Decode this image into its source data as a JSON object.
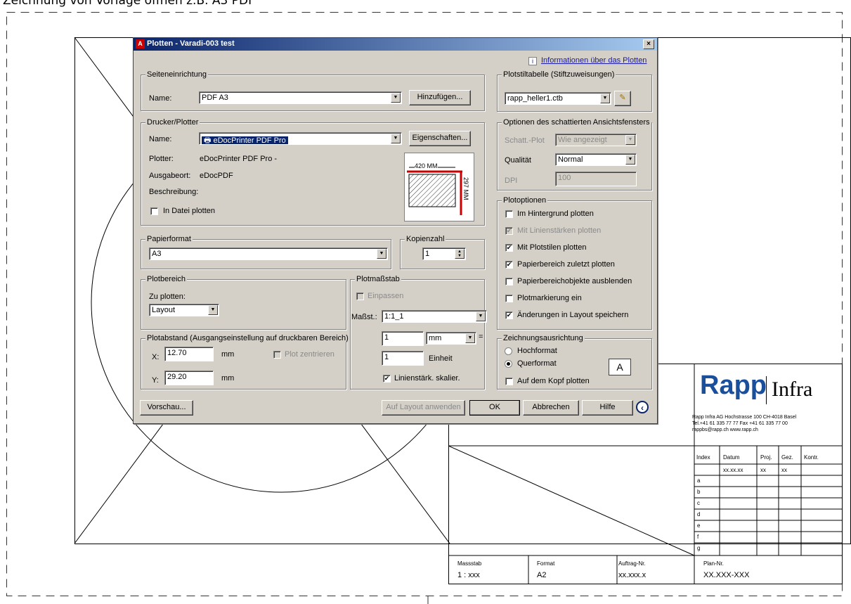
{
  "document": {
    "title": "Zeichnung von Vorlage öffnen z.B. A3 PDF"
  },
  "dialog": {
    "title": "Plotten - Varadi-003 test",
    "close_label": "×",
    "info_link": "Informationen über das Plotten",
    "page_setup": {
      "group": "Seiteneinrichtung",
      "name_label": "Name:",
      "name_value": "PDF A3",
      "add_button": "Hinzufügen..."
    },
    "printer": {
      "group": "Drucker/Plotter",
      "name_label": "Name:",
      "name_value": "eDocPrinter PDF Pro",
      "properties_button": "Eigenschaften...",
      "plotter_label": "Plotter:",
      "plotter_value": "eDocPrinter PDF Pro -",
      "output_label": "Ausgabeort:",
      "output_value": "eDocPDF",
      "desc_label": "Beschreibung:",
      "to_file_label": "In Datei plotten",
      "preview_width": "420 MM",
      "preview_height": "297 MM"
    },
    "paper": {
      "group": "Papierformat",
      "value": "A3"
    },
    "copies": {
      "group": "Kopienzahl",
      "value": "1"
    },
    "plot_area": {
      "group": "Plotbereich",
      "what_label": "Zu plotten:",
      "what_value": "Layout"
    },
    "plot_scale": {
      "group": "Plotmaßstab",
      "fit_label": "Einpassen",
      "scale_label": "Maßst.:",
      "scale_value": "1:1_1",
      "value1": "1",
      "unit": "mm",
      "equals": "=",
      "value2": "1",
      "unit2": "Einheit",
      "lineweight_label": "Linienstärk. skalier."
    },
    "offset": {
      "group": "Plotabstand (Ausgangseinstellung auf druckbaren Bereich)",
      "x_label": "X:",
      "x_value": "12.70",
      "x_unit": "mm",
      "center_label": "Plot zentrieren",
      "y_label": "Y:",
      "y_value": "29.20",
      "y_unit": "mm"
    },
    "style_table": {
      "group": "Plotstiltabelle (Stiftzuweisungen)",
      "value": "rapp_heller1.ctb"
    },
    "shaded": {
      "group": "Optionen des schattierten Ansichtsfensters",
      "shade_label": "Schatt.-Plot",
      "shade_value": "Wie angezeigt",
      "quality_label": "Qualität",
      "quality_value": "Normal",
      "dpi_label": "DPI",
      "dpi_value": "100"
    },
    "plot_options": {
      "group": "Plotoptionen",
      "items": [
        {
          "label": "Im Hintergrund plotten",
          "checked": false,
          "disabled": false
        },
        {
          "label": "Mit Linienstärken plotten",
          "checked": true,
          "disabled": true
        },
        {
          "label": "Mit Plotstilen plotten",
          "checked": true,
          "disabled": false
        },
        {
          "label": "Papierbereich zuletzt plotten",
          "checked": true,
          "disabled": false
        },
        {
          "label": "Papierbereichobjekte ausblenden",
          "checked": false,
          "disabled": false
        },
        {
          "label": "Plotmarkierung ein",
          "checked": false,
          "disabled": false
        },
        {
          "label": "Änderungen in Layout speichern",
          "checked": true,
          "disabled": false
        }
      ]
    },
    "orientation": {
      "group": "Zeichnungsausrichtung",
      "portrait": "Hochformat",
      "landscape": "Querformat",
      "upside_down": "Auf dem Kopf plotten",
      "icon_letter": "A"
    },
    "buttons": {
      "preview": "Vorschau...",
      "apply_layout": "Auf Layout anwenden",
      "ok": "OK",
      "cancel": "Abbrechen",
      "help": "Hilfe"
    }
  },
  "title_block": {
    "logo_main": "Rapp",
    "logo_sub": "Infra",
    "address1": "Rapp Infra AG Hochstrasse 100 CH-4018 Basel",
    "address2": "Tel.+41 61 335 77 77  Fax +41 61 335 77 00",
    "address3": "rappbs@rapp.ch www.rapp.ch",
    "rev_headers": [
      "Index",
      "Datum",
      "Proj.",
      "Gez.",
      "Kontr."
    ],
    "rev_first": [
      "",
      "xx.xx.xx",
      "xx",
      "xx",
      ""
    ],
    "rev_indexes": [
      "a",
      "b",
      "c",
      "d",
      "e",
      "f",
      "g"
    ],
    "massstab_label": "Massstab",
    "massstab_value": "1 : xxx",
    "format_label": "Format",
    "format_value": "A2",
    "auftrag_label": "Auftrag-Nr.",
    "auftrag_value": "xx.xxx.x",
    "plan_label": "Plan-Nr.",
    "plan_value": "XX.XXX-XXX"
  }
}
